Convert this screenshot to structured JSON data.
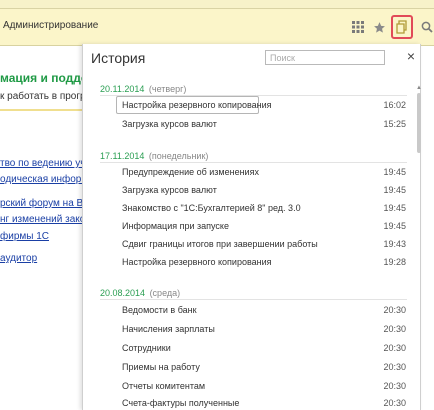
{
  "header": {
    "section_title": "Администрирование"
  },
  "background": {
    "heading": "мация и поддер",
    "text": "к работать в программ",
    "links": [
      "тво по ведению учета",
      "одическая информаци",
      "рский форум на BUH.R",
      "нг изменений законод",
      "фирмы 1С",
      "аудитор"
    ]
  },
  "history": {
    "title": "История",
    "search_placeholder": "Поиск",
    "close_label": "×",
    "groups": [
      {
        "date": "20.11.2014",
        "weekday": "(четверг)",
        "items": [
          {
            "label": "Настройка резервного копирования",
            "time": "16:02"
          },
          {
            "label": "Загрузка курсов валют",
            "time": "15:25"
          }
        ]
      },
      {
        "date": "17.11.2014",
        "weekday": "(понедельник)",
        "items": [
          {
            "label": "Предупреждение об изменениях",
            "time": "19:45"
          },
          {
            "label": "Загрузка курсов валют",
            "time": "19:45"
          },
          {
            "label": "Знакомство с \"1С:Бухгалтерией 8\" ред. 3.0",
            "time": "19:45"
          },
          {
            "label": "Информация при запуске",
            "time": "19:45"
          },
          {
            "label": "Сдвиг границы итогов при завершении работы",
            "time": "19:43"
          },
          {
            "label": "Настройка резервного копирования",
            "time": "19:28"
          }
        ]
      },
      {
        "date": "20.08.2014",
        "weekday": "(среда)",
        "items": [
          {
            "label": "Ведомости в банк",
            "time": "20:30"
          },
          {
            "label": "Начисления зарплаты",
            "time": "20:30"
          },
          {
            "label": "Сотрудники",
            "time": "20:30"
          },
          {
            "label": "Приемы на работу",
            "time": "20:30"
          },
          {
            "label": "Отчеты комитентам",
            "time": "20:30"
          },
          {
            "label": "Счета-фактуры полученные",
            "time": "20:30"
          }
        ]
      }
    ]
  }
}
